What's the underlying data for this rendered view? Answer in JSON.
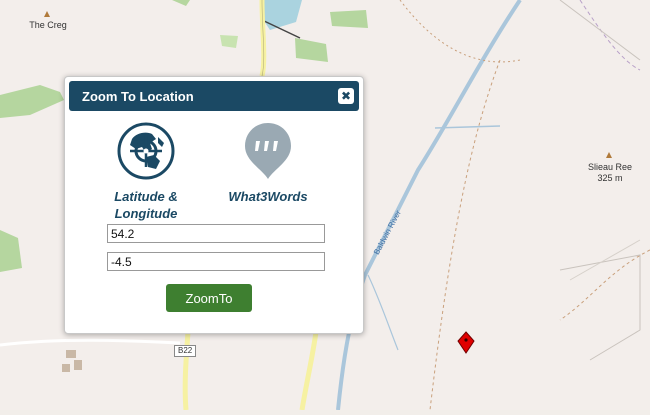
{
  "map": {
    "labels": {
      "the_creg": "The Creg",
      "slieau_ree": "Slieau Ree",
      "slieau_ree_height": "325 m",
      "river": "Baldwin River",
      "road": "B22"
    }
  },
  "dialog": {
    "title": "Zoom To Location",
    "close_label": "✖",
    "options": {
      "latlon_label": "Latitude & Longitude",
      "w3w_label": "What3Words"
    },
    "latitude_value": "54.2",
    "longitude_value": "-4.5",
    "zoom_button_label": "ZoomTo"
  },
  "colors": {
    "header": "#1b4964",
    "zoom_button": "#3e7f30",
    "icon_blue": "#1b4964",
    "icon_grey": "#9aa9b3",
    "marker": "#e00000"
  }
}
